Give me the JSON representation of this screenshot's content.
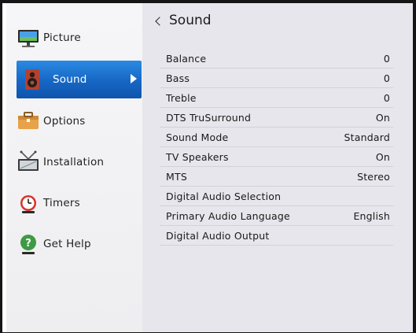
{
  "sidebar": {
    "items": [
      {
        "label": "Picture",
        "icon": "picture-icon"
      },
      {
        "label": "Sound",
        "icon": "speaker-icon"
      },
      {
        "label": "Options",
        "icon": "toolbox-icon"
      },
      {
        "label": "Installation",
        "icon": "antenna-icon"
      },
      {
        "label": "Timers",
        "icon": "alarm-clock-icon"
      },
      {
        "label": "Get Help",
        "icon": "help-icon"
      }
    ],
    "selected_index": 1,
    "selected_color": "#1766c4"
  },
  "panel": {
    "title": "Sound",
    "rows": [
      {
        "label": "Balance",
        "value": "0"
      },
      {
        "label": "Bass",
        "value": "0"
      },
      {
        "label": "Treble",
        "value": "0"
      },
      {
        "label": "DTS TruSurround",
        "value": "On"
      },
      {
        "label": "Sound Mode",
        "value": "Standard"
      },
      {
        "label": "TV Speakers",
        "value": "On"
      },
      {
        "label": "MTS",
        "value": "Stereo"
      },
      {
        "label": "Digital Audio Selection",
        "value": ""
      },
      {
        "label": "Primary Audio Language",
        "value": "English"
      },
      {
        "label": "Digital Audio Output",
        "value": ""
      }
    ]
  }
}
